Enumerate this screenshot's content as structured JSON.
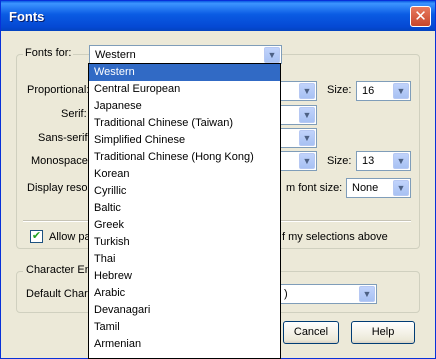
{
  "window": {
    "title": "Fonts",
    "close_glyph": "✕"
  },
  "fonts_for": {
    "label": "Fonts for:",
    "value": "Western"
  },
  "proportional": {
    "label": "Proportional:",
    "size_label": "Size:",
    "size_value": "16"
  },
  "serif": {
    "label": "Serif:"
  },
  "sans_serif": {
    "label": "Sans-serif:"
  },
  "monospace": {
    "label": "Monospace:",
    "size_label": "Size:",
    "size_value": "13"
  },
  "display_resolution": {
    "label": "Display resolu",
    "min_font_label": "m font size:",
    "min_font_value": "None"
  },
  "allow_pages": {
    "label": "Allow pa",
    "suffix": "f my selections above",
    "checked": true
  },
  "encoding": {
    "legend": "Character En",
    "default_label": "Default Char",
    "value": ")"
  },
  "buttons": {
    "cancel": "Cancel",
    "help": "Help"
  },
  "dropdown": {
    "options": [
      "Western",
      "Central European",
      "Japanese",
      "Traditional Chinese (Taiwan)",
      "Simplified Chinese",
      "Traditional Chinese (Hong Kong)",
      "Korean",
      "Cyrillic",
      "Baltic",
      "Greek",
      "Turkish",
      "Thai",
      "Hebrew",
      "Arabic",
      "Devanagari",
      "Tamil",
      "Armenian"
    ],
    "selected_index": 0
  },
  "colors": {
    "title_bar": "#0a5be3",
    "selection": "#316ac5",
    "dialog_bg": "#ece9d8"
  }
}
